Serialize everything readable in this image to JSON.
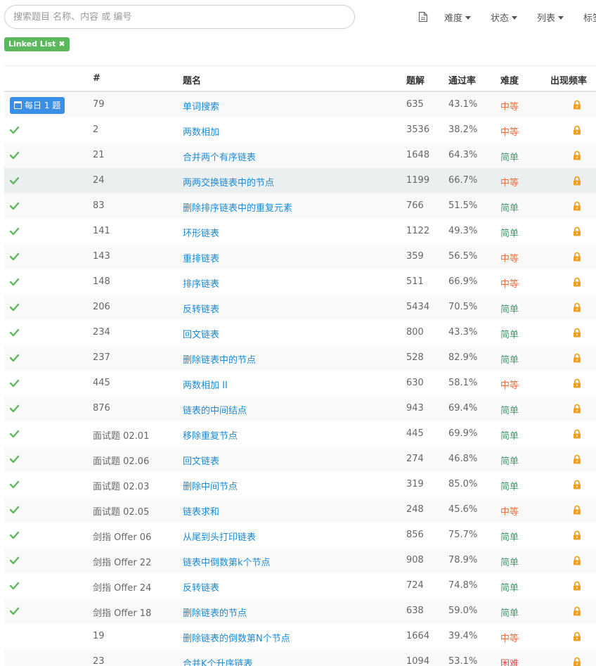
{
  "search": {
    "placeholder": "搜索题目 名称、内容 或 编号",
    "value": ""
  },
  "filters": {
    "difficulty": "难度",
    "status": "状态",
    "list": "列表",
    "tags": "标签"
  },
  "active_tag": {
    "label": "Linked List"
  },
  "daily_label": "每日 1 题",
  "headers": {
    "id": "#",
    "title": "题名",
    "solutions": "题解",
    "acceptance": "通过率",
    "difficulty": "难度",
    "frequency": "出现频率"
  },
  "colors": {
    "link": "#1a8ad8",
    "easy": "#3c9a6b",
    "medium": "#ec6f3e",
    "hard": "#e04d4d",
    "check": "#5cb85c",
    "lock": "#f0a020",
    "daily_badge": "#3a8ee6"
  },
  "rows": [
    {
      "daily": true,
      "solved": false,
      "id": "79",
      "title": "单词搜索",
      "solutions": "635",
      "rate": "43.1%",
      "difficulty": "中等",
      "level": "mid",
      "icon": "lock-icon"
    },
    {
      "daily": false,
      "solved": true,
      "id": "2",
      "title": "两数相加",
      "solutions": "3536",
      "rate": "38.2%",
      "difficulty": "中等",
      "level": "mid",
      "icon": "lock-icon"
    },
    {
      "daily": false,
      "solved": true,
      "id": "21",
      "title": "合并两个有序链表",
      "solutions": "1648",
      "rate": "64.3%",
      "difficulty": "简单",
      "level": "easy",
      "icon": "lock-icon"
    },
    {
      "daily": false,
      "solved": true,
      "id": "24",
      "title": "两两交换链表中的节点",
      "solutions": "1199",
      "rate": "66.7%",
      "difficulty": "中等",
      "level": "mid",
      "icon": "lock-icon",
      "highlight": true
    },
    {
      "daily": false,
      "solved": true,
      "id": "83",
      "title": "删除排序链表中的重复元素",
      "solutions": "766",
      "rate": "51.5%",
      "difficulty": "简单",
      "level": "easy",
      "icon": "lock-icon"
    },
    {
      "daily": false,
      "solved": true,
      "id": "141",
      "title": "环形链表",
      "solutions": "1122",
      "rate": "49.3%",
      "difficulty": "简单",
      "level": "easy",
      "icon": "lock-icon"
    },
    {
      "daily": false,
      "solved": true,
      "id": "143",
      "title": "重排链表",
      "solutions": "359",
      "rate": "56.5%",
      "difficulty": "中等",
      "level": "mid",
      "icon": "lock-icon"
    },
    {
      "daily": false,
      "solved": true,
      "id": "148",
      "title": "排序链表",
      "solutions": "511",
      "rate": "66.9%",
      "difficulty": "中等",
      "level": "mid",
      "icon": "lock-icon"
    },
    {
      "daily": false,
      "solved": true,
      "id": "206",
      "title": "反转链表",
      "solutions": "5434",
      "rate": "70.5%",
      "difficulty": "简单",
      "level": "easy",
      "icon": "lock-icon"
    },
    {
      "daily": false,
      "solved": true,
      "id": "234",
      "title": "回文链表",
      "solutions": "800",
      "rate": "43.3%",
      "difficulty": "简单",
      "level": "easy",
      "icon": "lock-icon"
    },
    {
      "daily": false,
      "solved": true,
      "id": "237",
      "title": "删除链表中的节点",
      "solutions": "528",
      "rate": "82.9%",
      "difficulty": "简单",
      "level": "easy",
      "icon": "lock-icon"
    },
    {
      "daily": false,
      "solved": true,
      "id": "445",
      "title": "两数相加 II",
      "solutions": "630",
      "rate": "58.1%",
      "difficulty": "中等",
      "level": "mid",
      "icon": "lock-icon"
    },
    {
      "daily": false,
      "solved": true,
      "id": "876",
      "title": "链表的中间结点",
      "solutions": "943",
      "rate": "69.4%",
      "difficulty": "简单",
      "level": "easy",
      "icon": "lock-icon"
    },
    {
      "daily": false,
      "solved": true,
      "id": "面试题 02.01",
      "title": "移除重复节点",
      "solutions": "445",
      "rate": "69.9%",
      "difficulty": "简单",
      "level": "easy",
      "icon": "lock-icon"
    },
    {
      "daily": false,
      "solved": true,
      "id": "面试题 02.06",
      "title": "回文链表",
      "solutions": "274",
      "rate": "46.8%",
      "difficulty": "简单",
      "level": "easy",
      "icon": "lock-icon"
    },
    {
      "daily": false,
      "solved": true,
      "id": "面试题 02.03",
      "title": "删除中间节点",
      "solutions": "319",
      "rate": "85.0%",
      "difficulty": "简单",
      "level": "easy",
      "icon": "lock-icon"
    },
    {
      "daily": false,
      "solved": true,
      "id": "面试题 02.05",
      "title": "链表求和",
      "solutions": "248",
      "rate": "45.6%",
      "difficulty": "中等",
      "level": "mid",
      "icon": "lock-icon"
    },
    {
      "daily": false,
      "solved": true,
      "id": "剑指 Offer 06",
      "title": "从尾到头打印链表",
      "solutions": "856",
      "rate": "75.7%",
      "difficulty": "简单",
      "level": "easy",
      "icon": "lock-icon"
    },
    {
      "daily": false,
      "solved": true,
      "id": "剑指 Offer 22",
      "title": "链表中倒数第k个节点",
      "solutions": "908",
      "rate": "78.9%",
      "difficulty": "简单",
      "level": "easy",
      "icon": "lock-icon"
    },
    {
      "daily": false,
      "solved": true,
      "id": "剑指 Offer 24",
      "title": "反转链表",
      "solutions": "724",
      "rate": "74.8%",
      "difficulty": "简单",
      "level": "easy",
      "icon": "lock-icon"
    },
    {
      "daily": false,
      "solved": true,
      "id": "剑指 Offer 18",
      "title": "删除链表的节点",
      "solutions": "638",
      "rate": "59.0%",
      "difficulty": "简单",
      "level": "easy",
      "icon": "lock-icon"
    },
    {
      "daily": false,
      "solved": false,
      "id": "19",
      "title": "删除链表的倒数第N个节点",
      "solutions": "1664",
      "rate": "39.4%",
      "difficulty": "中等",
      "level": "mid",
      "icon": "lock-icon"
    },
    {
      "daily": false,
      "solved": false,
      "id": "23",
      "title": "合并K个升序链表",
      "solutions": "1094",
      "rate": "53.1%",
      "difficulty": "困难",
      "level": "hard",
      "icon": "lock-icon"
    }
  ]
}
